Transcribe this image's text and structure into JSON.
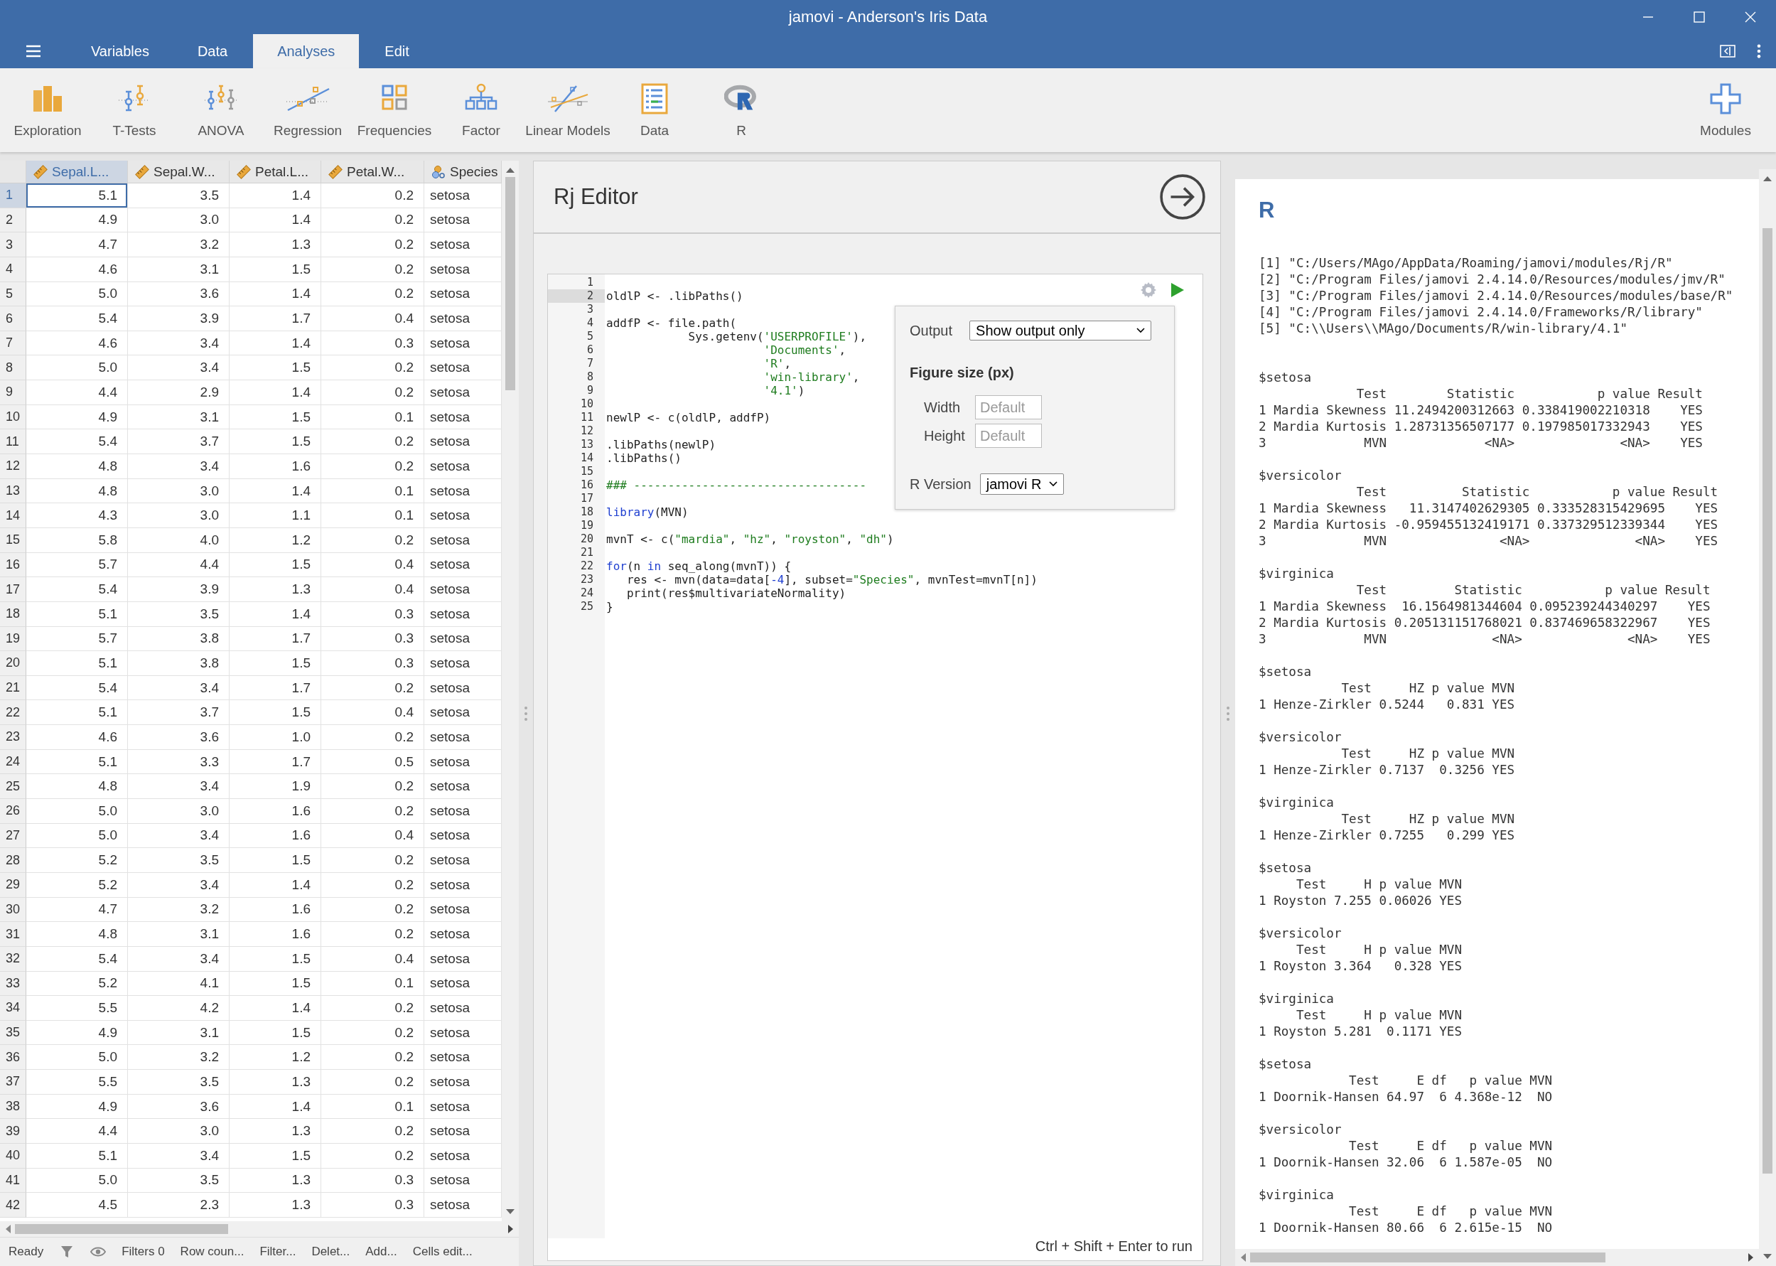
{
  "window": {
    "title": "jamovi - Anderson's Iris Data"
  },
  "tabs": [
    {
      "label": "Variables",
      "selected": false
    },
    {
      "label": "Data",
      "selected": false
    },
    {
      "label": "Analyses",
      "selected": true
    },
    {
      "label": "Edit",
      "selected": false
    }
  ],
  "ribbon": [
    {
      "label": "Exploration"
    },
    {
      "label": "T-Tests"
    },
    {
      "label": "ANOVA"
    },
    {
      "label": "Regression"
    },
    {
      "label": "Frequencies"
    },
    {
      "label": "Factor"
    },
    {
      "label": "Linear Models"
    },
    {
      "label": "Data"
    },
    {
      "label": "R"
    }
  ],
  "modules": {
    "label": "Modules"
  },
  "table": {
    "columns": [
      {
        "label": "Sepal.L...",
        "kind": "continuous",
        "selected": true
      },
      {
        "label": "Sepal.W...",
        "kind": "continuous",
        "selected": false
      },
      {
        "label": "Petal.L...",
        "kind": "continuous",
        "selected": false
      },
      {
        "label": "Petal.W...",
        "kind": "continuous",
        "selected": false
      },
      {
        "label": "Species",
        "kind": "nominal",
        "selected": false
      }
    ],
    "rows": [
      {
        "number": "1",
        "selected": true,
        "cells": [
          "5.1",
          "3.5",
          "1.4",
          "0.2",
          "setosa"
        ]
      },
      {
        "number": "2",
        "selected": false,
        "cells": [
          "4.9",
          "3.0",
          "1.4",
          "0.2",
          "setosa"
        ]
      },
      {
        "number": "3",
        "selected": false,
        "cells": [
          "4.7",
          "3.2",
          "1.3",
          "0.2",
          "setosa"
        ]
      },
      {
        "number": "4",
        "selected": false,
        "cells": [
          "4.6",
          "3.1",
          "1.5",
          "0.2",
          "setosa"
        ]
      },
      {
        "number": "5",
        "selected": false,
        "cells": [
          "5.0",
          "3.6",
          "1.4",
          "0.2",
          "setosa"
        ]
      },
      {
        "number": "6",
        "selected": false,
        "cells": [
          "5.4",
          "3.9",
          "1.7",
          "0.4",
          "setosa"
        ]
      },
      {
        "number": "7",
        "selected": false,
        "cells": [
          "4.6",
          "3.4",
          "1.4",
          "0.3",
          "setosa"
        ]
      },
      {
        "number": "8",
        "selected": false,
        "cells": [
          "5.0",
          "3.4",
          "1.5",
          "0.2",
          "setosa"
        ]
      },
      {
        "number": "9",
        "selected": false,
        "cells": [
          "4.4",
          "2.9",
          "1.4",
          "0.2",
          "setosa"
        ]
      },
      {
        "number": "10",
        "selected": false,
        "cells": [
          "4.9",
          "3.1",
          "1.5",
          "0.1",
          "setosa"
        ]
      },
      {
        "number": "11",
        "selected": false,
        "cells": [
          "5.4",
          "3.7",
          "1.5",
          "0.2",
          "setosa"
        ]
      },
      {
        "number": "12",
        "selected": false,
        "cells": [
          "4.8",
          "3.4",
          "1.6",
          "0.2",
          "setosa"
        ]
      },
      {
        "number": "13",
        "selected": false,
        "cells": [
          "4.8",
          "3.0",
          "1.4",
          "0.1",
          "setosa"
        ]
      },
      {
        "number": "14",
        "selected": false,
        "cells": [
          "4.3",
          "3.0",
          "1.1",
          "0.1",
          "setosa"
        ]
      },
      {
        "number": "15",
        "selected": false,
        "cells": [
          "5.8",
          "4.0",
          "1.2",
          "0.2",
          "setosa"
        ]
      },
      {
        "number": "16",
        "selected": false,
        "cells": [
          "5.7",
          "4.4",
          "1.5",
          "0.4",
          "setosa"
        ]
      },
      {
        "number": "17",
        "selected": false,
        "cells": [
          "5.4",
          "3.9",
          "1.3",
          "0.4",
          "setosa"
        ]
      },
      {
        "number": "18",
        "selected": false,
        "cells": [
          "5.1",
          "3.5",
          "1.4",
          "0.3",
          "setosa"
        ]
      },
      {
        "number": "19",
        "selected": false,
        "cells": [
          "5.7",
          "3.8",
          "1.7",
          "0.3",
          "setosa"
        ]
      },
      {
        "number": "20",
        "selected": false,
        "cells": [
          "5.1",
          "3.8",
          "1.5",
          "0.3",
          "setosa"
        ]
      },
      {
        "number": "21",
        "selected": false,
        "cells": [
          "5.4",
          "3.4",
          "1.7",
          "0.2",
          "setosa"
        ]
      },
      {
        "number": "22",
        "selected": false,
        "cells": [
          "5.1",
          "3.7",
          "1.5",
          "0.4",
          "setosa"
        ]
      },
      {
        "number": "23",
        "selected": false,
        "cells": [
          "4.6",
          "3.6",
          "1.0",
          "0.2",
          "setosa"
        ]
      },
      {
        "number": "24",
        "selected": false,
        "cells": [
          "5.1",
          "3.3",
          "1.7",
          "0.5",
          "setosa"
        ]
      },
      {
        "number": "25",
        "selected": false,
        "cells": [
          "4.8",
          "3.4",
          "1.9",
          "0.2",
          "setosa"
        ]
      },
      {
        "number": "26",
        "selected": false,
        "cells": [
          "5.0",
          "3.0",
          "1.6",
          "0.2",
          "setosa"
        ]
      },
      {
        "number": "27",
        "selected": false,
        "cells": [
          "5.0",
          "3.4",
          "1.6",
          "0.4",
          "setosa"
        ]
      },
      {
        "number": "28",
        "selected": false,
        "cells": [
          "5.2",
          "3.5",
          "1.5",
          "0.2",
          "setosa"
        ]
      },
      {
        "number": "29",
        "selected": false,
        "cells": [
          "5.2",
          "3.4",
          "1.4",
          "0.2",
          "setosa"
        ]
      },
      {
        "number": "30",
        "selected": false,
        "cells": [
          "4.7",
          "3.2",
          "1.6",
          "0.2",
          "setosa"
        ]
      },
      {
        "number": "31",
        "selected": false,
        "cells": [
          "4.8",
          "3.1",
          "1.6",
          "0.2",
          "setosa"
        ]
      },
      {
        "number": "32",
        "selected": false,
        "cells": [
          "5.4",
          "3.4",
          "1.5",
          "0.4",
          "setosa"
        ]
      },
      {
        "number": "33",
        "selected": false,
        "cells": [
          "5.2",
          "4.1",
          "1.5",
          "0.1",
          "setosa"
        ]
      },
      {
        "number": "34",
        "selected": false,
        "cells": [
          "5.5",
          "4.2",
          "1.4",
          "0.2",
          "setosa"
        ]
      },
      {
        "number": "35",
        "selected": false,
        "cells": [
          "4.9",
          "3.1",
          "1.5",
          "0.2",
          "setosa"
        ]
      },
      {
        "number": "36",
        "selected": false,
        "cells": [
          "5.0",
          "3.2",
          "1.2",
          "0.2",
          "setosa"
        ]
      },
      {
        "number": "37",
        "selected": false,
        "cells": [
          "5.5",
          "3.5",
          "1.3",
          "0.2",
          "setosa"
        ]
      },
      {
        "number": "38",
        "selected": false,
        "cells": [
          "4.9",
          "3.6",
          "1.4",
          "0.1",
          "setosa"
        ]
      },
      {
        "number": "39",
        "selected": false,
        "cells": [
          "4.4",
          "3.0",
          "1.3",
          "0.2",
          "setosa"
        ]
      },
      {
        "number": "40",
        "selected": false,
        "cells": [
          "5.1",
          "3.4",
          "1.5",
          "0.2",
          "setosa"
        ]
      },
      {
        "number": "41",
        "selected": false,
        "cells": [
          "5.0",
          "3.5",
          "1.3",
          "0.3",
          "setosa"
        ]
      },
      {
        "number": "42",
        "selected": false,
        "cells": [
          "4.5",
          "2.3",
          "1.3",
          "0.3",
          "setosa"
        ]
      }
    ]
  },
  "status_bar": {
    "state": "Ready",
    "filters": "Filters 0",
    "items": [
      "Row coun...",
      "Filter...",
      "Delet...",
      "Add...",
      "Cells edit..."
    ]
  },
  "editor": {
    "title": "Rj Editor",
    "hint": "Ctrl + Shift + Enter to run",
    "lines": [
      {
        "number": "1",
        "current": false
      },
      {
        "number": "2",
        "current": true,
        "code": [
          {
            "text": "oldlP <- .libPaths()",
            "kind": "plain"
          }
        ]
      },
      {
        "number": "3",
        "current": false
      },
      {
        "number": "4",
        "current": false,
        "code": [
          {
            "text": "addfP <- file.path(",
            "kind": "plain"
          }
        ]
      },
      {
        "number": "5",
        "current": false,
        "code": [
          {
            "text": "            Sys.getenv(",
            "kind": "plain"
          },
          {
            "text": "'USERPROFILE'",
            "kind": "string"
          },
          {
            "text": "),",
            "kind": "plain"
          }
        ]
      },
      {
        "number": "6",
        "current": false,
        "code": [
          {
            "text": "                       'Documents'",
            "kind": "string"
          },
          {
            "text": ",",
            "kind": "plain"
          }
        ]
      },
      {
        "number": "7",
        "current": false,
        "code": [
          {
            "text": "                       'R'",
            "kind": "string"
          },
          {
            "text": ",",
            "kind": "plain"
          }
        ]
      },
      {
        "number": "8",
        "current": false,
        "code": [
          {
            "text": "                       'win-library'",
            "kind": "string"
          },
          {
            "text": ",",
            "kind": "plain"
          }
        ]
      },
      {
        "number": "9",
        "current": false,
        "code": [
          {
            "text": "                       '4.1'",
            "kind": "string"
          },
          {
            "text": ")",
            "kind": "plain"
          }
        ]
      },
      {
        "number": "10",
        "current": false
      },
      {
        "number": "11",
        "current": false,
        "code": [
          {
            "text": "newlP <- c(oldlP, addfP)",
            "kind": "plain"
          }
        ]
      },
      {
        "number": "12",
        "current": false
      },
      {
        "number": "13",
        "current": false,
        "code": [
          {
            "text": ".libPaths(newlP)",
            "kind": "plain"
          }
        ]
      },
      {
        "number": "14",
        "current": false,
        "code": [
          {
            "text": ".libPaths()",
            "kind": "plain"
          }
        ]
      },
      {
        "number": "15",
        "current": false
      },
      {
        "number": "16",
        "current": false,
        "code": [
          {
            "text": "### ----------------------------------",
            "kind": "comment"
          }
        ]
      },
      {
        "number": "17",
        "current": false
      },
      {
        "number": "18",
        "current": false,
        "code": [
          {
            "text": "library",
            "kind": "keyword"
          },
          {
            "text": "(MVN)",
            "kind": "plain"
          }
        ]
      },
      {
        "number": "19",
        "current": false
      },
      {
        "number": "20",
        "current": false,
        "code": [
          {
            "text": "mvnT <- c(",
            "kind": "plain"
          },
          {
            "text": "\"mardia\"",
            "kind": "string"
          },
          {
            "text": ", ",
            "kind": "plain"
          },
          {
            "text": "\"hz\"",
            "kind": "string"
          },
          {
            "text": ", ",
            "kind": "plain"
          },
          {
            "text": "\"royston\"",
            "kind": "string"
          },
          {
            "text": ", ",
            "kind": "plain"
          },
          {
            "text": "\"dh\"",
            "kind": "string"
          },
          {
            "text": ")",
            "kind": "plain"
          }
        ]
      },
      {
        "number": "21",
        "current": false
      },
      {
        "number": "22",
        "current": false,
        "code": [
          {
            "text": "for",
            "kind": "keyword"
          },
          {
            "text": "(n ",
            "kind": "plain"
          },
          {
            "text": "in",
            "kind": "keyword"
          },
          {
            "text": " seq_along(mvnT)) {",
            "kind": "plain"
          }
        ]
      },
      {
        "number": "23",
        "current": false,
        "code": [
          {
            "text": "   res <- mvn(data=data[",
            "kind": "plain"
          },
          {
            "text": "-4",
            "kind": "number"
          },
          {
            "text": "], subset=",
            "kind": "plain"
          },
          {
            "text": "\"Species\"",
            "kind": "string"
          },
          {
            "text": ", mvnTest=mvnT[n])",
            "kind": "plain"
          }
        ]
      },
      {
        "number": "24",
        "current": false,
        "code": [
          {
            "text": "   print(res$multivariateNormality)",
            "kind": "plain"
          }
        ]
      },
      {
        "number": "25",
        "current": false,
        "code": [
          {
            "text": "}",
            "kind": "plain"
          }
        ]
      }
    ],
    "options": {
      "output_label": "Output",
      "output_value": "Show output only",
      "figure_heading": "Figure size (px)",
      "width_label": "Width",
      "width_placeholder": "Default",
      "height_label": "Height",
      "height_placeholder": "Default",
      "version_label": "R Version",
      "version_value": "jamovi R"
    }
  },
  "output": {
    "title": "R",
    "blocks": [
      {
        "lines": [
          "[1] \"C:/Users/MAgo/AppData/Roaming/jamovi/modules/Rj/R\"",
          "[2] \"C:/Program Files/jamovi 2.4.14.0/Resources/modules/jmv/R\"",
          "[3] \"C:/Program Files/jamovi 2.4.14.0/Resources/modules/base/R\"",
          "[4] \"C:/Program Files/jamovi 2.4.14.0/Frameworks/R/library\"",
          "[5] \"C:\\\\Users\\\\MAgo/Documents/R/win-library/4.1\""
        ]
      },
      {
        "lines": [
          "$setosa",
          "             Test        Statistic           p value Result",
          "1 Mardia Skewness 11.2494200312663 0.338419002210318    YES",
          "2 Mardia Kurtosis 1.28731356507177 0.197985017332943    YES",
          "3             MVN             <NA>              <NA>    YES"
        ]
      },
      {
        "lines": [
          "$versicolor",
          "             Test          Statistic           p value Result",
          "1 Mardia Skewness   11.3147402629305 0.333528315429695    YES",
          "2 Mardia Kurtosis -0.959455132419171 0.337329512339344    YES",
          "3             MVN               <NA>              <NA>    YES"
        ]
      },
      {
        "lines": [
          "$virginica",
          "             Test         Statistic           p value Result",
          "1 Mardia Skewness  16.1564981344604 0.095239244340297    YES",
          "2 Mardia Kurtosis 0.205131151768021 0.837469658322967    YES",
          "3             MVN              <NA>              <NA>    YES"
        ]
      },
      {
        "lines": [
          "$setosa",
          "           Test     HZ p value MVN",
          "1 Henze-Zirkler 0.5244   0.831 YES"
        ]
      },
      {
        "lines": [
          "$versicolor",
          "           Test     HZ p value MVN",
          "1 Henze-Zirkler 0.7137  0.3256 YES"
        ]
      },
      {
        "lines": [
          "$virginica",
          "           Test     HZ p value MVN",
          "1 Henze-Zirkler 0.7255   0.299 YES"
        ]
      },
      {
        "lines": [
          "$setosa",
          "     Test     H p value MVN",
          "1 Royston 7.255 0.06026 YES"
        ]
      },
      {
        "lines": [
          "$versicolor",
          "     Test     H p value MVN",
          "1 Royston 3.364   0.328 YES"
        ]
      },
      {
        "lines": [
          "$virginica",
          "     Test     H p value MVN",
          "1 Royston 5.281  0.1171 YES"
        ]
      },
      {
        "lines": [
          "$setosa",
          "            Test     E df   p value MVN",
          "1 Doornik-Hansen 64.97  6 4.368e-12  NO"
        ]
      },
      {
        "lines": [
          "$versicolor",
          "            Test     E df   p value MVN",
          "1 Doornik-Hansen 32.06  6 1.587e-05  NO"
        ]
      },
      {
        "lines": [
          "$virginica",
          "            Test     E df   p value MVN",
          "1 Doornik-Hansen 80.66  6 2.615e-15  NO"
        ]
      }
    ]
  }
}
